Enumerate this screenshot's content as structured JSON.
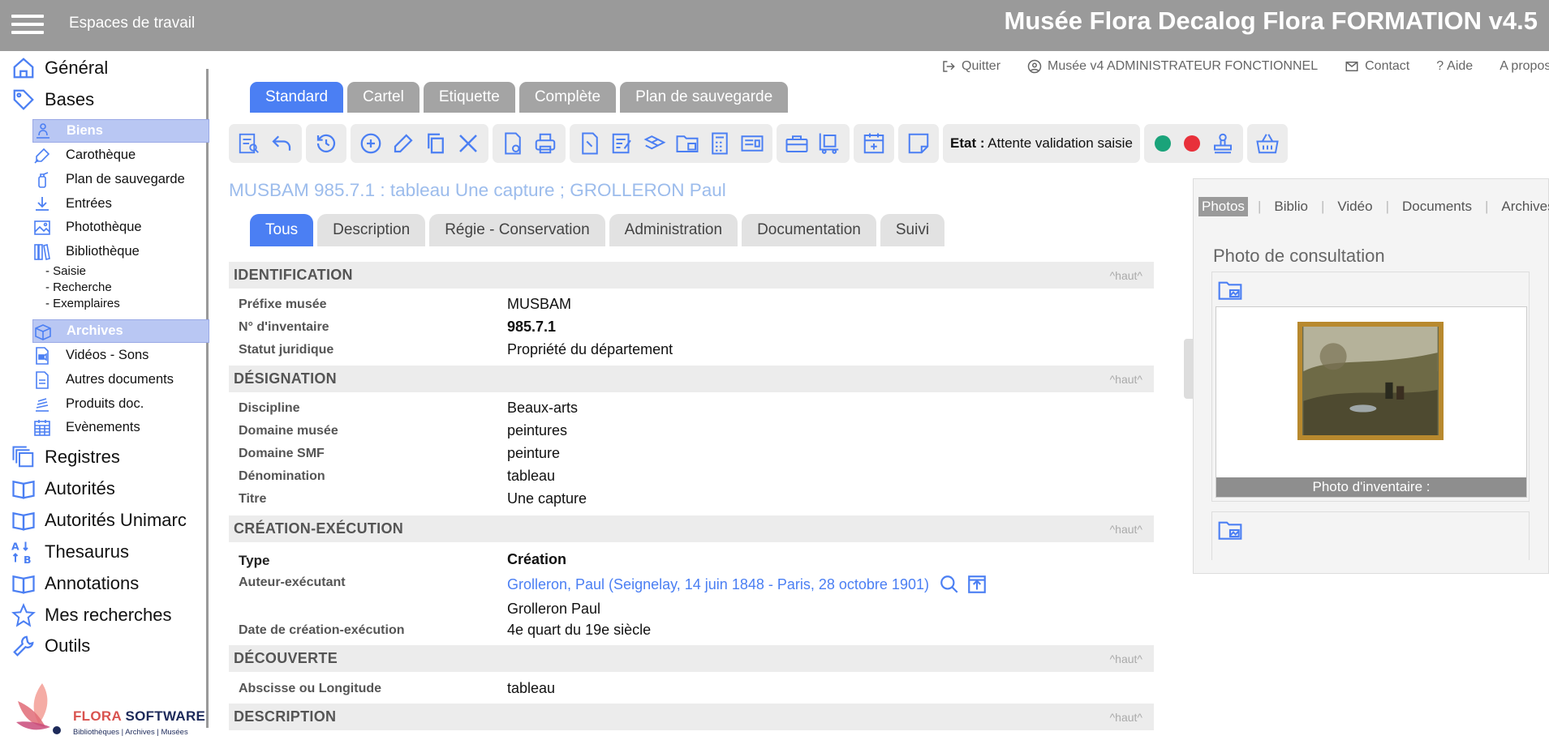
{
  "header": {
    "workspaces": "Espaces de travail",
    "title": "Musée Flora Decalog Flora FORMATION v4.5"
  },
  "sidebar": {
    "top_items": [
      {
        "label": "Général",
        "icon": "home-icon"
      },
      {
        "label": "Bases",
        "icon": "tag-icon"
      }
    ],
    "base_items": [
      {
        "label": "Biens",
        "icon": "object-icon",
        "selected": true
      },
      {
        "label": "Carothèque",
        "icon": "pen-icon"
      },
      {
        "label": "Plan de sauvegarde",
        "icon": "extinguisher-icon"
      },
      {
        "label": "Entrées",
        "icon": "download-icon"
      },
      {
        "label": "Photothèque",
        "icon": "image-icon"
      },
      {
        "label": "Bibliothèque",
        "icon": "books-icon"
      }
    ],
    "bib_sub": [
      "- Saisie",
      "- Recherche",
      "- Exemplaires"
    ],
    "base_items2": [
      {
        "label": "Archives",
        "icon": "box-icon",
        "selected": true
      },
      {
        "label": "Vidéos - Sons",
        "icon": "video-file-icon"
      },
      {
        "label": "Autres documents",
        "icon": "document-icon"
      },
      {
        "label": "Produits doc.",
        "icon": "layers-icon"
      },
      {
        "label": "Evènements",
        "icon": "calendar-icon"
      }
    ],
    "bottom_items": [
      {
        "label": "Registres",
        "icon": "registers-icon"
      },
      {
        "label": "Autorités",
        "icon": "book-icon"
      },
      {
        "label": "Autorités Unimarc",
        "icon": "book-icon"
      },
      {
        "label": "Thesaurus",
        "icon": "sort-az-icon"
      },
      {
        "label": "Annotations",
        "icon": "book-icon"
      },
      {
        "label": "Mes recherches",
        "icon": "star-icon"
      },
      {
        "label": "Outils",
        "icon": "wrench-icon"
      }
    ],
    "logo": {
      "brand1": "FLORA",
      "brand2": "SOFTWARE",
      "tagline": "Bibliothèques | Archives | Musées"
    }
  },
  "toplinks": [
    {
      "label": "Quitter",
      "icon": "logout-icon"
    },
    {
      "label": "Musée v4 ADMINISTRATEUR FONCTIONNEL",
      "icon": "user-icon"
    },
    {
      "label": "Contact",
      "icon": "mail-icon"
    },
    {
      "label": "Aide",
      "icon": "help-icon"
    },
    {
      "label": "A propos",
      "icon": ""
    }
  ],
  "view_tabs": [
    "Standard",
    "Cartel",
    "Etiquette",
    "Complète",
    "Plan de sauvegarde"
  ],
  "active_view_tab": "Standard",
  "toolbar": {
    "etat_label": "Etat :",
    "etat_value": "Attente validation saisie",
    "green": "#1aa37a",
    "red": "#e8303a"
  },
  "record_title": "MUSBAM 985.7.1 : tableau Une capture ; GROLLERON Paul",
  "section_tabs": [
    "Tous",
    "Description",
    "Régie - Conservation",
    "Administration",
    "Documentation",
    "Suivi"
  ],
  "active_section_tab": "Tous",
  "up_label": "^haut^",
  "sections": {
    "identification": {
      "title": "IDENTIFICATION",
      "rows": [
        {
          "label": "Préfixe musée",
          "value": "MUSBAM"
        },
        {
          "label": "N° d'inventaire",
          "value": "985.7.1"
        },
        {
          "label": "Statut juridique",
          "value": "Propriété du département"
        }
      ]
    },
    "designation": {
      "title": "DÉSIGNATION",
      "rows": [
        {
          "label": "Discipline",
          "value": "Beaux-arts"
        },
        {
          "label": "Domaine musée",
          "value": "peintures"
        },
        {
          "label": "Domaine SMF",
          "value": "peinture"
        },
        {
          "label": "Dénomination",
          "value": "tableau"
        },
        {
          "label": "Titre",
          "value": "Une capture"
        }
      ]
    },
    "creation": {
      "title": "CRÉATION-EXÉCUTION",
      "type_label": "Type",
      "type_value": "Création",
      "author_label": "Auteur-exécutant",
      "author_link": "Grolleron, Paul (Seignelay, 14 juin 1848 - Paris, 28 octobre 1901)",
      "author_name": "Grolleron Paul",
      "date_label": "Date de création-exécution",
      "date_value": "4e quart du 19e siècle"
    },
    "decouverte": {
      "title": "DÉCOUVERTE",
      "rows": [
        {
          "label": "Abscisse ou Longitude",
          "value": "tableau"
        }
      ]
    },
    "description": {
      "title": "DESCRIPTION"
    }
  },
  "right_panel": {
    "tabs": [
      "Photos",
      "Biblio",
      "Vidéo",
      "Documents",
      "Archives"
    ],
    "active_tab": "Photos",
    "photo_heading": "Photo de consultation",
    "photo_caption": "Photo d'inventaire :"
  },
  "colors": {
    "accent": "#4b7ff3",
    "header": "#9a9a9a",
    "selected_nav": "#b9c7f3"
  }
}
